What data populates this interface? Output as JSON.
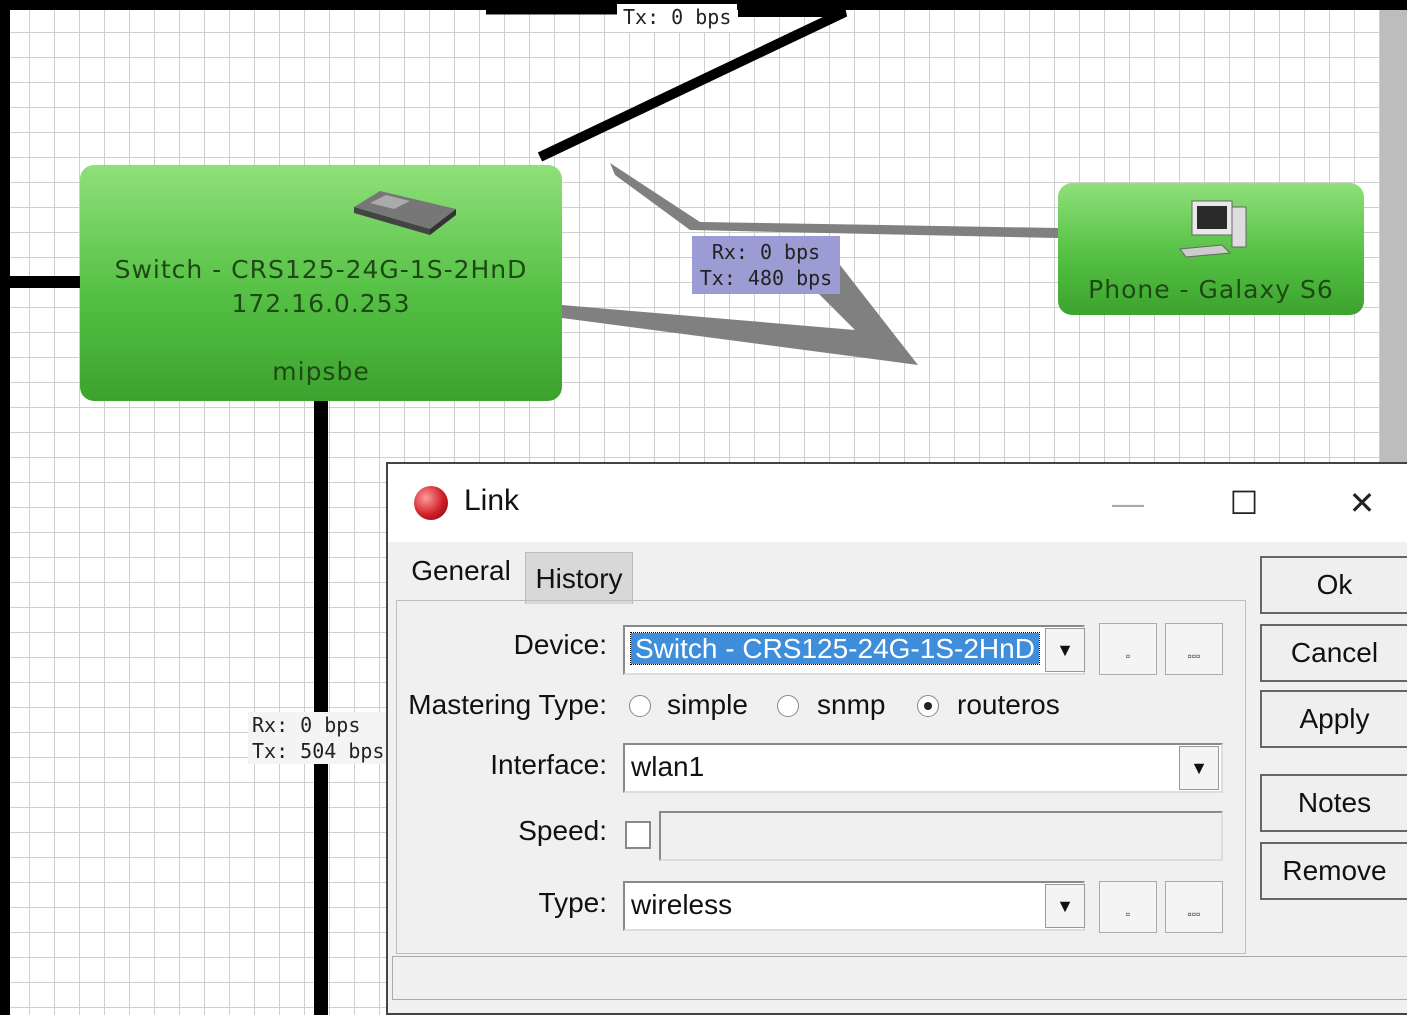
{
  "map": {
    "switch_node": {
      "name": "Switch - CRS125-24G-1S-2HnD",
      "ip": "172.16.0.253",
      "arch": "mipsbe",
      "icon": "switch-device-icon"
    },
    "phone_node": {
      "name": "Phone - Galaxy S6",
      "icon": "computer-icon"
    },
    "rates": {
      "top": {
        "tx": "Tx: 0 bps"
      },
      "middle": {
        "rx": "Rx: 0 bps",
        "tx": "Tx: 480 bps"
      },
      "left": {
        "rx": "Rx: 0 bps",
        "tx": "Tx: 504 bps"
      }
    }
  },
  "dialog": {
    "title": "Link",
    "window_buttons": {
      "minimize": "—",
      "maximize": "☐",
      "close": "✕"
    },
    "tabs": [
      "General",
      "History"
    ],
    "active_tab": "General",
    "fields": {
      "device": {
        "label": "Device:",
        "value": "Switch - CRS125-24G-1S-2HnD"
      },
      "mastering_type": {
        "label": "Mastering Type:",
        "options": [
          "simple",
          "snmp",
          "routeros"
        ],
        "selected": "routeros"
      },
      "interface": {
        "label": "Interface:",
        "value": "wlan1"
      },
      "speed": {
        "label": "Speed:",
        "checked": false,
        "value": ""
      },
      "type": {
        "label": "Type:",
        "value": "wireless"
      }
    },
    "side_buttons": {
      "ok": "Ok",
      "cancel": "Cancel",
      "apply": "Apply",
      "notes": "Notes",
      "remove": "Remove"
    },
    "small_buttons": {
      "single": "▫",
      "multi": "▫▫▫"
    }
  },
  "colors": {
    "node_green": "#55c044",
    "rate_label_bg": "#9c9cd4",
    "selection_blue": "#3e8edb",
    "link_gray": "#808080"
  }
}
